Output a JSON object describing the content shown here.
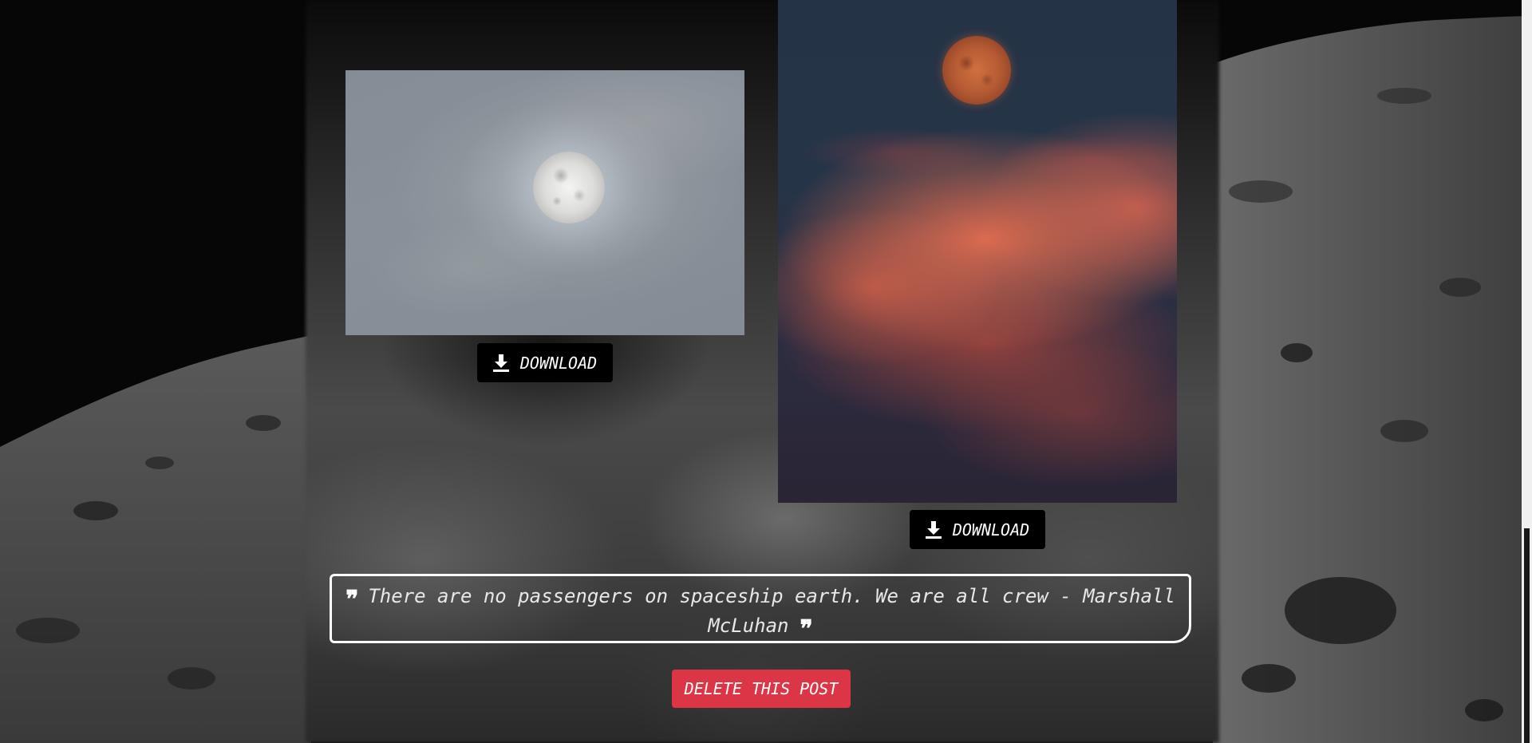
{
  "gallery": {
    "images": [
      {
        "alt": "Full moon surrounded by clouds",
        "download_label": "DOWNLOAD",
        "icon": "download-icon"
      },
      {
        "alt": "Red moon above orange clouds",
        "download_label": "DOWNLOAD",
        "icon": "download-icon"
      }
    ]
  },
  "quote": {
    "text": "There are no passengers on spaceship earth. We are all crew - Marshall McLuhan",
    "open_icon": "quote-icon",
    "close_icon": "quote-icon"
  },
  "actions": {
    "delete_label": "DELETE THIS POST",
    "delete_color": "#dc3545"
  },
  "colors": {
    "button_bg": "#000000",
    "quote_border": "#ffffff"
  }
}
